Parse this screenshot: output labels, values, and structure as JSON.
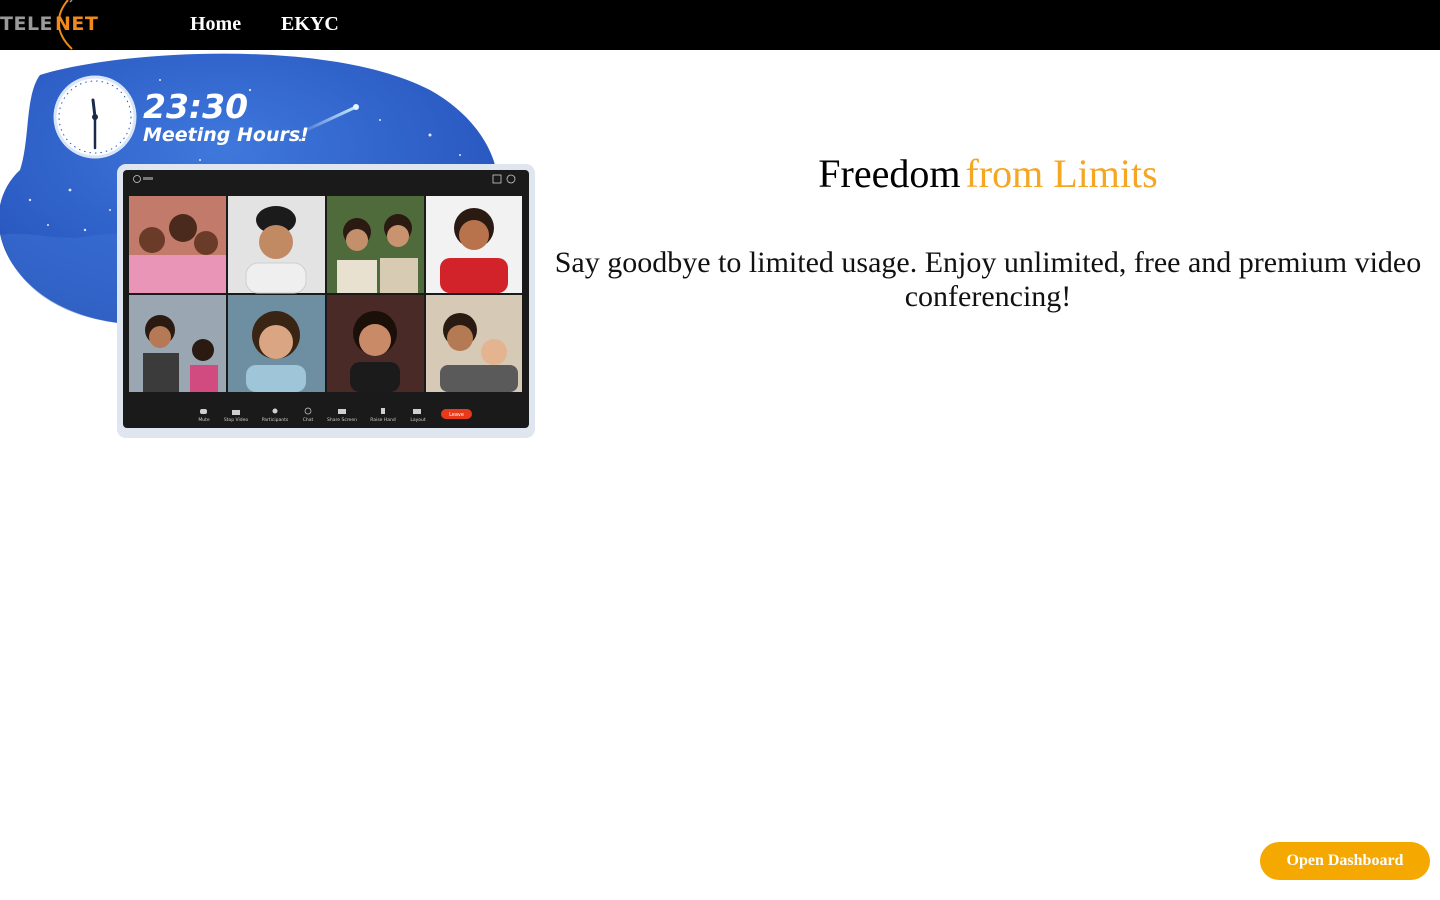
{
  "brand": {
    "part1": "TELE",
    "part2": "NET"
  },
  "nav": {
    "items": [
      {
        "label": "Home"
      },
      {
        "label": "EKYC"
      }
    ]
  },
  "hero_art": {
    "time": "23:30",
    "caption": "Meeting Hours!",
    "toolbar_items": [
      "Mute",
      "Stop Video",
      "Participants",
      "Chat",
      "Share Screen",
      "Raise Hand",
      "Layout"
    ],
    "leave_label": "Leave"
  },
  "headline": {
    "part1": "Freedom",
    "part2": "from Limits"
  },
  "subtext": "Say goodbye to limited usage. Enjoy unlimited, free and premium video conferencing!",
  "dashboard_button": {
    "label": "Open Dashboard"
  },
  "colors": {
    "accent": "#f5a623",
    "button": "#f5a800",
    "nav_bg": "#000000",
    "hero_blue": "#2f63c9"
  }
}
